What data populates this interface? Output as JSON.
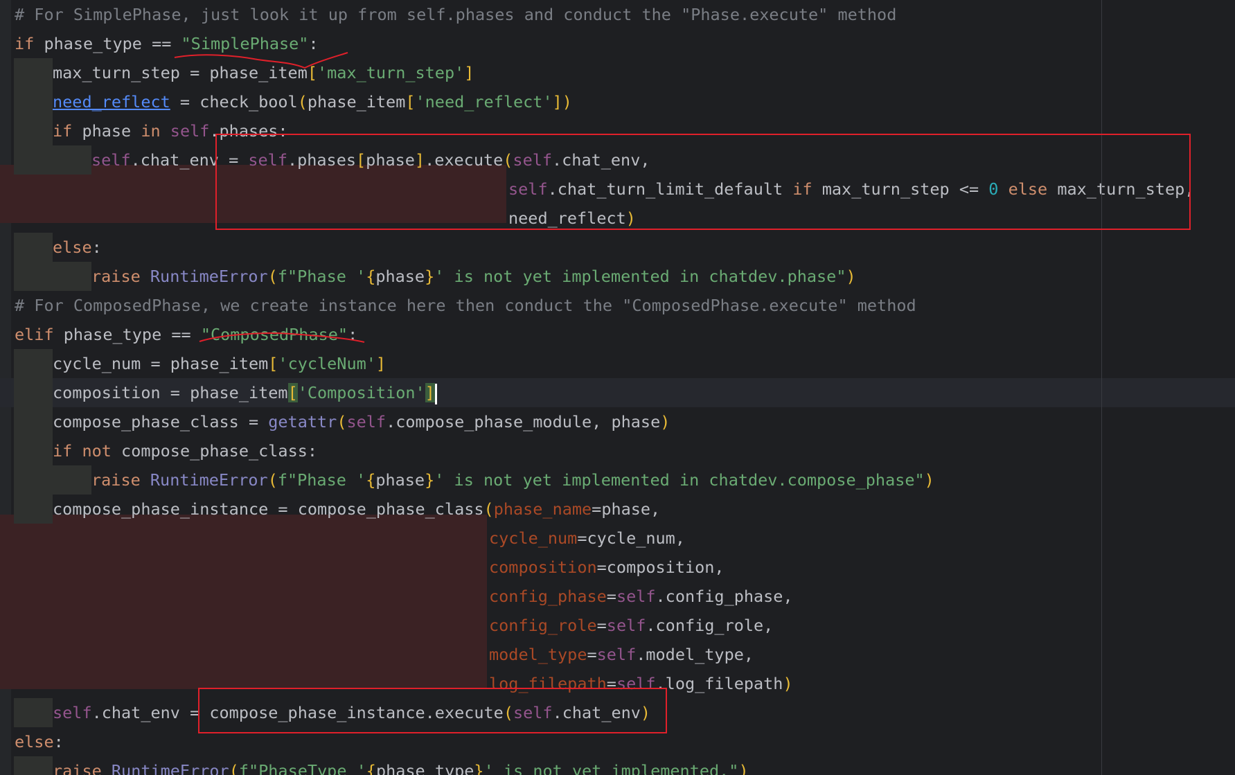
{
  "colors": {
    "background": "#1e1f22",
    "text": "#bcbec4",
    "keyword": "#cf8e6d",
    "self": "#94558d",
    "string": "#6aab73",
    "comment": "#7a7e85",
    "function": "#56a8f5",
    "builtin": "#8888c6",
    "number": "#2aacb8",
    "param": "#aa4926",
    "bracket": "#e8ba36",
    "link": "#548af7",
    "annotation": "#e0202a"
  },
  "lines": [
    [
      {
        "t": "# For SimplePhase, just look it up from self.phases and conduct the \"Phase.execute\" method",
        "k": "comment"
      }
    ],
    [
      {
        "t": "if",
        "k": "keyword"
      },
      {
        "t": " phase_type == ",
        "k": "text"
      },
      {
        "t": "\"SimplePhase\"",
        "k": "string"
      },
      {
        "t": ":",
        "k": "text"
      }
    ],
    [
      {
        "t": "max_turn_step = phase_item",
        "k": "text"
      },
      {
        "t": "[",
        "k": "bracket"
      },
      {
        "t": "'max_turn_step'",
        "k": "string"
      },
      {
        "t": "]",
        "k": "bracket"
      }
    ],
    [
      {
        "t": "need_reflect",
        "k": "link"
      },
      {
        "t": " = check_bool",
        "k": "text"
      },
      {
        "t": "(",
        "k": "bracket"
      },
      {
        "t": "phase_item",
        "k": "text"
      },
      {
        "t": "[",
        "k": "bracket"
      },
      {
        "t": "'need_reflect'",
        "k": "string"
      },
      {
        "t": "])",
        "k": "bracket"
      }
    ],
    [
      {
        "t": "if",
        "k": "keyword"
      },
      {
        "t": " phase ",
        "k": "text"
      },
      {
        "t": "in",
        "k": "keyword"
      },
      {
        "t": " ",
        "k": "text"
      },
      {
        "t": "self",
        "k": "self"
      },
      {
        "t": ".phases:",
        "k": "text"
      }
    ],
    [
      {
        "t": "self",
        "k": "self"
      },
      {
        "t": ".chat_env = ",
        "k": "text"
      },
      {
        "t": "self",
        "k": "self"
      },
      {
        "t": ".phases",
        "k": "text"
      },
      {
        "t": "[",
        "k": "bracket"
      },
      {
        "t": "phase",
        "k": "text"
      },
      {
        "t": "]",
        "k": "bracket"
      },
      {
        "t": ".execute",
        "k": "text"
      },
      {
        "t": "(",
        "k": "bracket"
      },
      {
        "t": "self",
        "k": "self"
      },
      {
        "t": ".chat_env,",
        "k": "text"
      }
    ],
    [
      {
        "t": "self",
        "k": "self"
      },
      {
        "t": ".chat_turn_limit_default ",
        "k": "text"
      },
      {
        "t": "if",
        "k": "keyword"
      },
      {
        "t": " max_turn_step <= ",
        "k": "text"
      },
      {
        "t": "0",
        "k": "number"
      },
      {
        "t": " ",
        "k": "text"
      },
      {
        "t": "else",
        "k": "keyword"
      },
      {
        "t": " max_turn_step,",
        "k": "text"
      }
    ],
    [
      {
        "t": "need_reflect",
        "k": "text"
      },
      {
        "t": ")",
        "k": "bracket"
      }
    ],
    [
      {
        "t": "else",
        "k": "keyword"
      },
      {
        "t": ":",
        "k": "text"
      }
    ],
    [
      {
        "t": "raise",
        "k": "keyword"
      },
      {
        "t": " ",
        "k": "text"
      },
      {
        "t": "RuntimeError",
        "k": "builtin"
      },
      {
        "t": "(",
        "k": "bracket"
      },
      {
        "t": "f\"Phase '",
        "k": "string"
      },
      {
        "t": "{",
        "k": "bracket"
      },
      {
        "t": "phase",
        "k": "text"
      },
      {
        "t": "}",
        "k": "bracket"
      },
      {
        "t": "' is not yet implemented in chatdev.phase\"",
        "k": "string"
      },
      {
        "t": ")",
        "k": "bracket"
      }
    ],
    [
      {
        "t": "# For ComposedPhase, we create instance here then conduct the \"ComposedPhase.execute\" method",
        "k": "comment"
      }
    ],
    [
      {
        "t": "elif",
        "k": "keyword"
      },
      {
        "t": " phase_type == ",
        "k": "text"
      },
      {
        "t": "\"ComposedPhase\"",
        "k": "string"
      },
      {
        "t": ":",
        "k": "text"
      }
    ],
    [
      {
        "t": "cycle_num = phase_item",
        "k": "text"
      },
      {
        "t": "[",
        "k": "bracket"
      },
      {
        "t": "'cycleNum'",
        "k": "string"
      },
      {
        "t": "]",
        "k": "bracket"
      }
    ],
    [
      {
        "t": "composition = phase_item",
        "k": "text"
      },
      {
        "t": "[",
        "k": "bracket"
      },
      {
        "t": "'Composition'",
        "k": "string"
      },
      {
        "t": "]",
        "k": "bracket"
      }
    ],
    [
      {
        "t": "compose_phase_class = ",
        "k": "text"
      },
      {
        "t": "getattr",
        "k": "builtin"
      },
      {
        "t": "(",
        "k": "bracket"
      },
      {
        "t": "self",
        "k": "self"
      },
      {
        "t": ".compose_phase_module, phase",
        "k": "text"
      },
      {
        "t": ")",
        "k": "bracket"
      }
    ],
    [
      {
        "t": "if",
        "k": "keyword"
      },
      {
        "t": " ",
        "k": "text"
      },
      {
        "t": "not",
        "k": "keyword"
      },
      {
        "t": " compose_phase_class:",
        "k": "text"
      }
    ],
    [
      {
        "t": "raise",
        "k": "keyword"
      },
      {
        "t": " ",
        "k": "text"
      },
      {
        "t": "RuntimeError",
        "k": "builtin"
      },
      {
        "t": "(",
        "k": "bracket"
      },
      {
        "t": "f\"Phase '",
        "k": "string"
      },
      {
        "t": "{",
        "k": "bracket"
      },
      {
        "t": "phase",
        "k": "text"
      },
      {
        "t": "}",
        "k": "bracket"
      },
      {
        "t": "' is not yet implemented in chatdev.compose_phase\"",
        "k": "string"
      },
      {
        "t": ")",
        "k": "bracket"
      }
    ],
    [
      {
        "t": "compose_phase_instance = compose_phase_class",
        "k": "text"
      },
      {
        "t": "(",
        "k": "bracket"
      },
      {
        "t": "phase_name",
        "k": "param"
      },
      {
        "t": "=phase,",
        "k": "text"
      }
    ],
    [
      {
        "t": "cycle_num",
        "k": "param"
      },
      {
        "t": "=cycle_num,",
        "k": "text"
      }
    ],
    [
      {
        "t": "composition",
        "k": "param"
      },
      {
        "t": "=composition,",
        "k": "text"
      }
    ],
    [
      {
        "t": "config_phase",
        "k": "param"
      },
      {
        "t": "=",
        "k": "text"
      },
      {
        "t": "self",
        "k": "self"
      },
      {
        "t": ".config_phase,",
        "k": "text"
      }
    ],
    [
      {
        "t": "config_role",
        "k": "param"
      },
      {
        "t": "=",
        "k": "text"
      },
      {
        "t": "self",
        "k": "self"
      },
      {
        "t": ".config_role,",
        "k": "text"
      }
    ],
    [
      {
        "t": "model_type",
        "k": "param"
      },
      {
        "t": "=",
        "k": "text"
      },
      {
        "t": "self",
        "k": "self"
      },
      {
        "t": ".model_type,",
        "k": "text"
      }
    ],
    [
      {
        "t": "log_filepath",
        "k": "param"
      },
      {
        "t": "=",
        "k": "text"
      },
      {
        "t": "self",
        "k": "self"
      },
      {
        "t": ".log_filepath",
        "k": "text"
      },
      {
        "t": ")",
        "k": "bracket"
      }
    ],
    [
      {
        "t": "self",
        "k": "self"
      },
      {
        "t": ".chat_env = compose_phase_instance.execute",
        "k": "text"
      },
      {
        "t": "(",
        "k": "bracket"
      },
      {
        "t": "self",
        "k": "self"
      },
      {
        "t": ".chat_env",
        "k": "text"
      },
      {
        "t": ")",
        "k": "bracket"
      }
    ],
    [
      {
        "t": "else",
        "k": "keyword"
      },
      {
        "t": ":",
        "k": "text"
      }
    ],
    [
      {
        "t": "raise",
        "k": "keyword"
      },
      {
        "t": " ",
        "k": "text"
      },
      {
        "t": "RuntimeError",
        "k": "builtin"
      },
      {
        "t": "(",
        "k": "bracket"
      },
      {
        "t": "f\"PhaseType '",
        "k": "string"
      },
      {
        "t": "{",
        "k": "bracket"
      },
      {
        "t": "phase_type",
        "k": "text"
      },
      {
        "t": "}",
        "k": "bracket"
      },
      {
        "t": "' is not yet implemented.\"",
        "k": "string"
      },
      {
        "t": ")",
        "k": "bracket"
      }
    ]
  ]
}
